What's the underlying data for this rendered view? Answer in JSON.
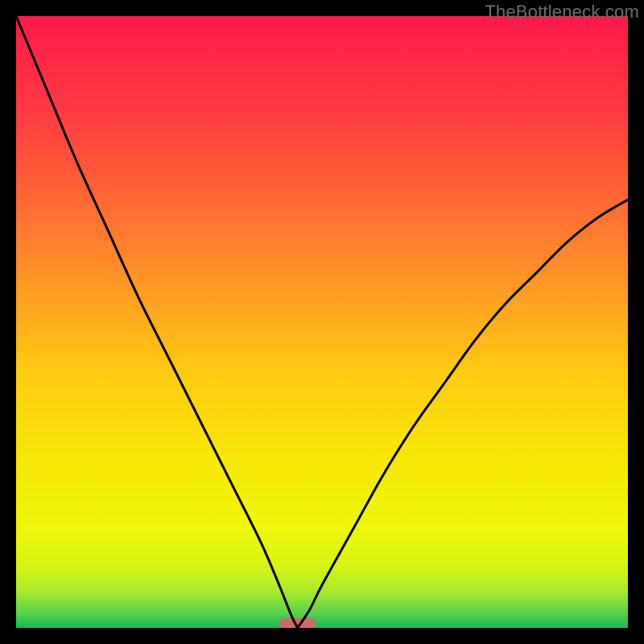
{
  "watermark": "TheBottleneck.com",
  "chart_data": {
    "type": "line",
    "title": "",
    "xlabel": "",
    "ylabel": "",
    "xlim": [
      0,
      100
    ],
    "ylim": [
      0,
      100
    ],
    "notes": "V-shaped curve with vertex near x≈46, y≈0 against a vertical red→yellow→green gradient. A small pink rounded marker sits at the vertex along the bottom edge. Left branch reaches the top-left corner; right branch exits the right edge around y≈70.",
    "series": [
      {
        "name": "left-branch",
        "x": [
          0,
          5,
          10,
          15,
          20,
          25,
          30,
          35,
          40,
          43,
          45,
          46
        ],
        "y": [
          100,
          88,
          76,
          65,
          54,
          44,
          34,
          24,
          14,
          7,
          2,
          0
        ]
      },
      {
        "name": "right-branch",
        "x": [
          46,
          48,
          50,
          55,
          60,
          65,
          70,
          75,
          80,
          85,
          90,
          95,
          100
        ],
        "y": [
          0,
          3,
          7,
          16,
          25,
          33,
          40,
          47,
          53,
          58,
          63,
          67,
          70
        ]
      }
    ],
    "gradient_stops": [
      {
        "offset": 0.0,
        "color": "#ff1a4b"
      },
      {
        "offset": 0.18,
        "color": "#ff4040"
      },
      {
        "offset": 0.4,
        "color": "#ff8a2a"
      },
      {
        "offset": 0.58,
        "color": "#ffca12"
      },
      {
        "offset": 0.72,
        "color": "#f7e607"
      },
      {
        "offset": 0.84,
        "color": "#eef70a"
      },
      {
        "offset": 0.9,
        "color": "#d6f316"
      },
      {
        "offset": 0.94,
        "color": "#a9ea2c"
      },
      {
        "offset": 0.975,
        "color": "#5ad34e"
      },
      {
        "offset": 1.0,
        "color": "#16b956"
      }
    ],
    "marker": {
      "x": 46,
      "y": 0,
      "width_pct": 6,
      "height_pct": 1.6,
      "fill": "#d06a6a"
    }
  }
}
